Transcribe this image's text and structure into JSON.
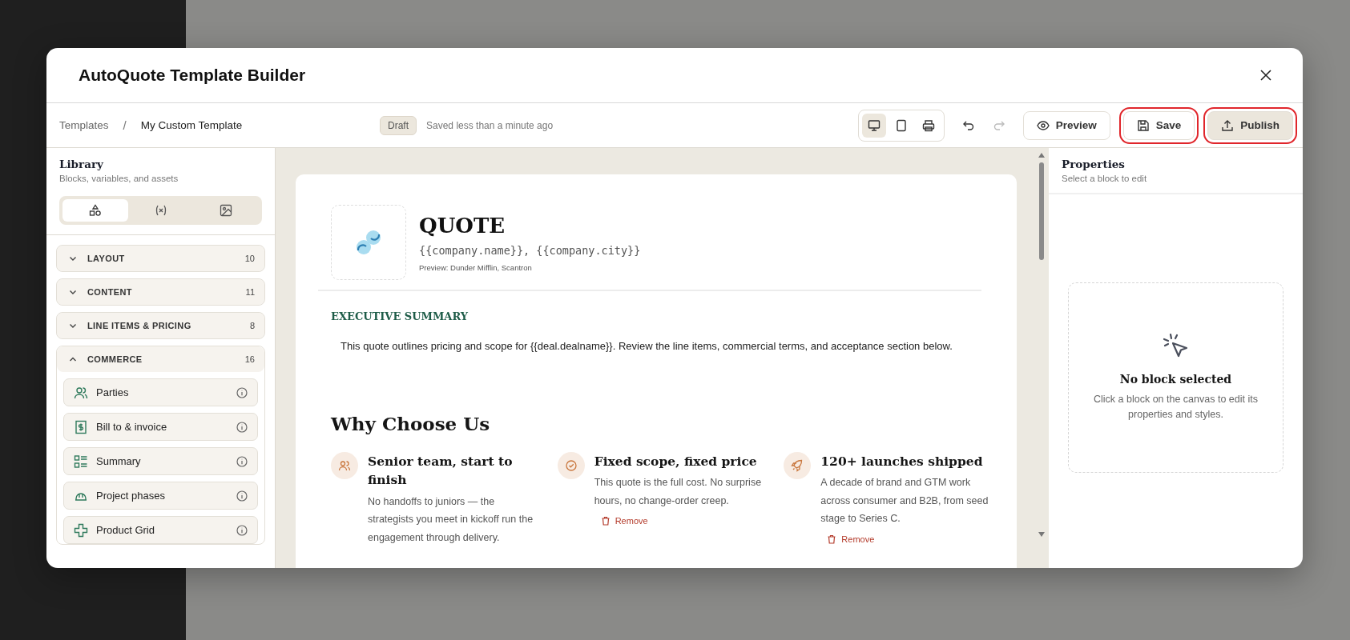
{
  "modal": {
    "title": "AutoQuote Template Builder"
  },
  "breadcrumb": {
    "items": [
      {
        "label": "Templates",
        "current": false
      },
      {
        "label": "My Custom Template",
        "current": true
      }
    ],
    "separator": "/"
  },
  "status": {
    "badge": "Draft",
    "saved": "Saved less than a minute ago"
  },
  "view_modes": [
    {
      "kind": "desktop",
      "selected": true
    },
    {
      "kind": "tablet",
      "selected": false
    },
    {
      "kind": "print",
      "selected": false
    }
  ],
  "history": [
    {
      "kind": "undo",
      "disabled": false
    },
    {
      "kind": "redo",
      "disabled": true
    }
  ],
  "actions": [
    {
      "kind": "preview",
      "label": "Preview",
      "highlighted": false
    },
    {
      "kind": "save",
      "label": "Save",
      "highlighted": true
    },
    {
      "kind": "publish",
      "label": "Publish",
      "highlighted": true
    }
  ],
  "library": {
    "title": "Library",
    "subtitle": "Blocks, variables, and assets",
    "tabs": [
      {
        "kind": "blocks",
        "selected": true
      },
      {
        "kind": "variables",
        "selected": false
      },
      {
        "kind": "assets",
        "selected": false
      }
    ],
    "categories": [
      {
        "label": "LAYOUT",
        "count": "10",
        "expanded": false
      },
      {
        "label": "CONTENT",
        "count": "11",
        "expanded": false
      },
      {
        "label": "LINE ITEMS & PRICING",
        "count": "8",
        "expanded": false
      },
      {
        "label": "COMMERCE",
        "count": "16",
        "expanded": true,
        "items": [
          {
            "kind": "people",
            "label": "Parties"
          },
          {
            "kind": "invoice",
            "label": "Bill to & invoice"
          },
          {
            "kind": "list",
            "label": "Summary"
          },
          {
            "kind": "helmet",
            "label": "Project phases"
          },
          {
            "kind": "cross",
            "label": "Product Grid"
          }
        ]
      }
    ]
  },
  "canvas": {
    "title": "QUOTE",
    "company": "{{company.name}}, {{company.city}}",
    "preview": "Preview: Dunder Mifflin, Scantron",
    "summary_heading": "EXECUTIVE SUMMARY",
    "summary": "This quote outlines pricing and scope for {{deal.dealname}}. Review the line items, commercial terms, and acceptance section below.",
    "why_heading": "Why Choose Us",
    "features": [
      {
        "kind": "people",
        "title": "Senior team, start to finish",
        "text": "No handoffs to juniors — the strategists you meet in kickoff run the engagement through delivery."
      },
      {
        "kind": "check",
        "title": "Fixed scope, fixed price",
        "text": "This quote is the full cost. No surprise hours, no change-order creep.",
        "remove": "Remove"
      },
      {
        "kind": "rocket",
        "title": "120+ launches shipped",
        "text": "A decade of brand and GTM work across consumer and B2B, from seed stage to Series C.",
        "remove": "Remove"
      }
    ]
  },
  "properties": {
    "title": "Properties",
    "subtitle": "Select a block to edit",
    "empty_title": "No block selected",
    "empty_text": "Click a block on the canvas to edit its properties and styles."
  }
}
